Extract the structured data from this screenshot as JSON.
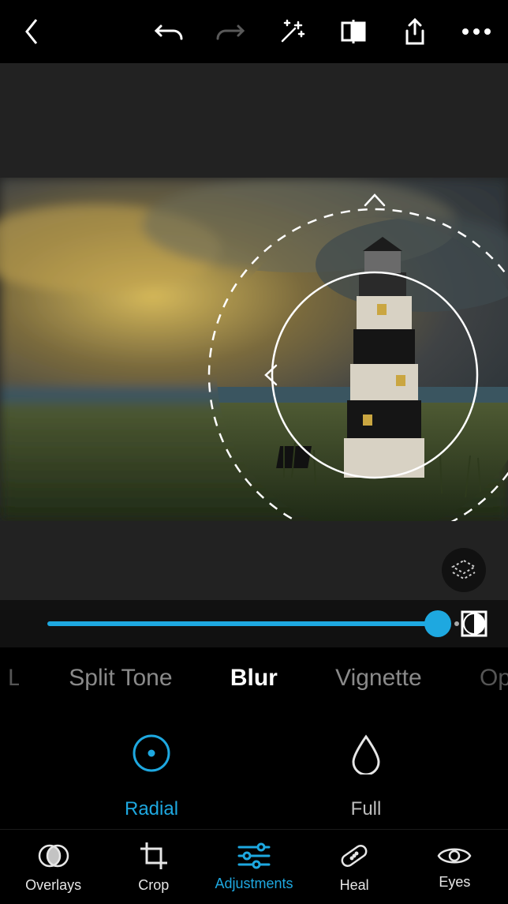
{
  "colors": {
    "accent": "#1ea8e0"
  },
  "slider": {
    "value": 100,
    "min": 0,
    "max": 100
  },
  "adjustments": {
    "tabs": [
      "Split Tone",
      "Blur",
      "Vignette"
    ],
    "active": "Blur",
    "edge_left": "L",
    "edge_right": "Opt"
  },
  "blur": {
    "modes": [
      {
        "key": "radial",
        "label": "Radial",
        "active": true
      },
      {
        "key": "full",
        "label": "Full",
        "active": false
      }
    ]
  },
  "nav": {
    "items": [
      {
        "key": "overlays",
        "label": "Overlays"
      },
      {
        "key": "crop",
        "label": "Crop"
      },
      {
        "key": "adjustments",
        "label": "Adjustments",
        "active": true
      },
      {
        "key": "heal",
        "label": "Heal"
      },
      {
        "key": "eyes",
        "label": "Eyes"
      }
    ]
  }
}
